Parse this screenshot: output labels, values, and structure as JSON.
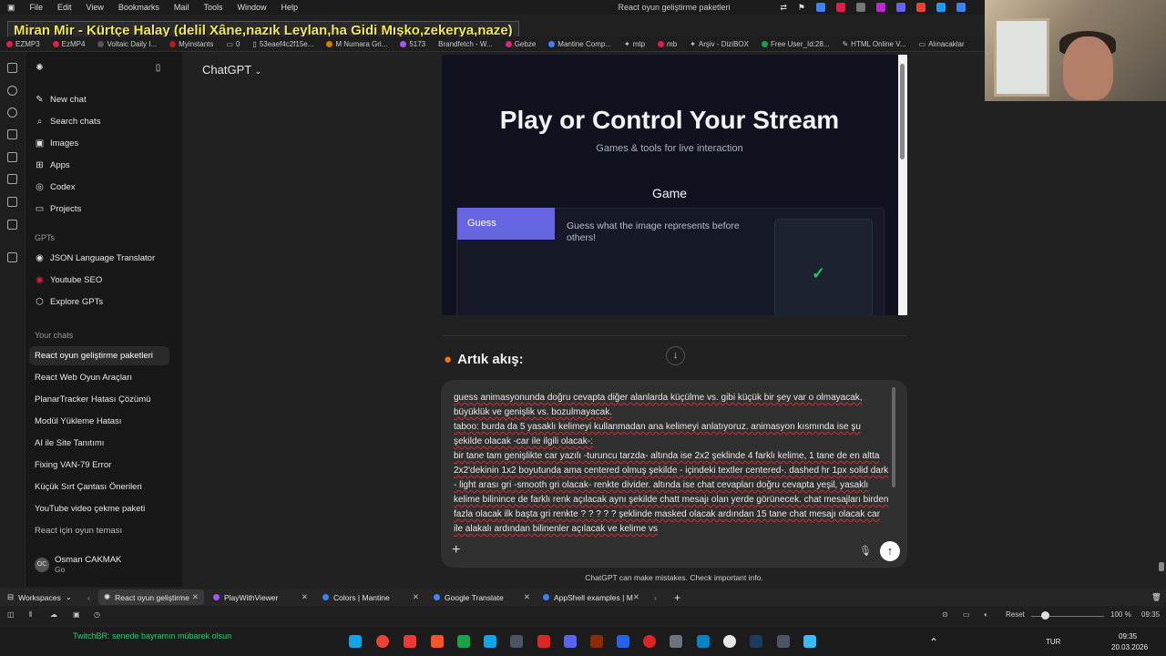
{
  "os_menu": {
    "items": [
      "File",
      "Edit",
      "View",
      "Bookmarks",
      "Mail",
      "Tools",
      "Window",
      "Help"
    ],
    "window_title": "React oyun geliştirme paketleri"
  },
  "now_playing": "Miran Mir - Kürtçe Halay (delil Xâne,nazık Leylan,ha Gidi Mışko,zekerya,naze)",
  "bookmarks": [
    "EZMP3",
    "EzMP4",
    "Voltaic Daily I...",
    "Myinstants",
    "0",
    "53eaef4c2f15e...",
    "M Numara Gri...",
    "5173",
    "Brandfetch - W...",
    "Gebze",
    "Mantine Comp...",
    "mtp",
    "mb",
    "Arşiv - DiziBOX",
    "Free User_Id:28...",
    "HTML Online V...",
    "Alınacaklar"
  ],
  "sidebar": {
    "nav": [
      {
        "label": "New chat",
        "icon": "edit-icon"
      },
      {
        "label": "Search chats",
        "icon": "search-icon"
      },
      {
        "label": "Images",
        "icon": "image-icon"
      },
      {
        "label": "Apps",
        "icon": "apps-icon"
      },
      {
        "label": "Codex",
        "icon": "codex-icon"
      },
      {
        "label": "Projects",
        "icon": "folder-icon"
      }
    ],
    "gpts_header": "GPTs",
    "gpts": [
      "JSON Language Translator",
      "Youtube SEO",
      "Explore GPTs"
    ],
    "chats_header": "Your chats",
    "chats": [
      "React oyun geliştirme paketleri",
      "React Web Oyun Araçları",
      "PlanarTracker Hatası Çözümü",
      "Modül Yükleme Hatası",
      "AI ile Site Tanıtımı",
      "Fixing VAN-79 Error",
      "Küçük Sırt Çantası Önerileri",
      "YouTube video çekme paketi",
      "React için oyun teması"
    ],
    "profile": {
      "initials": "OC",
      "name": "Osman CAKMAK",
      "plan": "Go"
    }
  },
  "header": {
    "model": "ChatGPT"
  },
  "preview": {
    "title": "Play or Control Your Stream",
    "subtitle": "Games & tools for live interaction",
    "section": "Game",
    "tab_label": "Guess",
    "description": "Guess what the image represents before others!",
    "check": "✓"
  },
  "message_heading": "Artık akış:",
  "composer": {
    "lines": [
      "guess animasyonunda doğru cevapta diğer alanlarda küçülme vs. gibi küçük bir şey var o olmayacak, büyüklük ve genişlik vs. bozulmayacak.",
      "taboo: burda da 5 yasaklı kelimeyi kullanmadan ana kelimeyi anlatıyoruz. animasyon kısmında ise şu şekilde olacak -car ile ilgili olacak-:",
      "bir tane tam genişlikte car yazılı -turuncu tarzda- altında ise 2x2 şeklinde 4 farklı kelime, 1 tane de en altta 2x2'dekinin 1x2 boyutunda ama centered olmuş şekilde - içindeki textler centered-. dashed hr 1px solid dark - light arası gri -smooth gri olacak- renkte divider. altında ise chat cevapları doğru cevapta yeşil, yasaklı kelime bilinince de farklı renk açılacak aynı şekilde chatt mesajı olan yerde görünecek. chat mesajları birden fazla olacak ilk başta gri renkte ? ? ? ? ? şeklinde masked olacak ardından 15 tane chat mesajı olacak car ile alakalı ardından bilinenler açılacak ve kelime vs"
    ],
    "disclaimer": "ChatGPT can make mistakes. Check important info."
  },
  "tabs": {
    "workspaces": "Workspaces",
    "items": [
      "React oyun geliştirme",
      "PlayWithViewer",
      "Colors | Mantine",
      "Google Translate",
      "AppShell examples | M"
    ]
  },
  "status": {
    "reset": "Reset",
    "zoom": "100 %",
    "time": "09:35"
  },
  "taskbar": {
    "notification": "TwitchBR: senede bayramın mübarek olsun",
    "lang": "TUR",
    "clock_time": "09:35",
    "clock_date": "20.03.2026"
  },
  "colors": {
    "accent": "#6664e0",
    "check": "#22c55e",
    "banner_text": "#f3e85a"
  }
}
